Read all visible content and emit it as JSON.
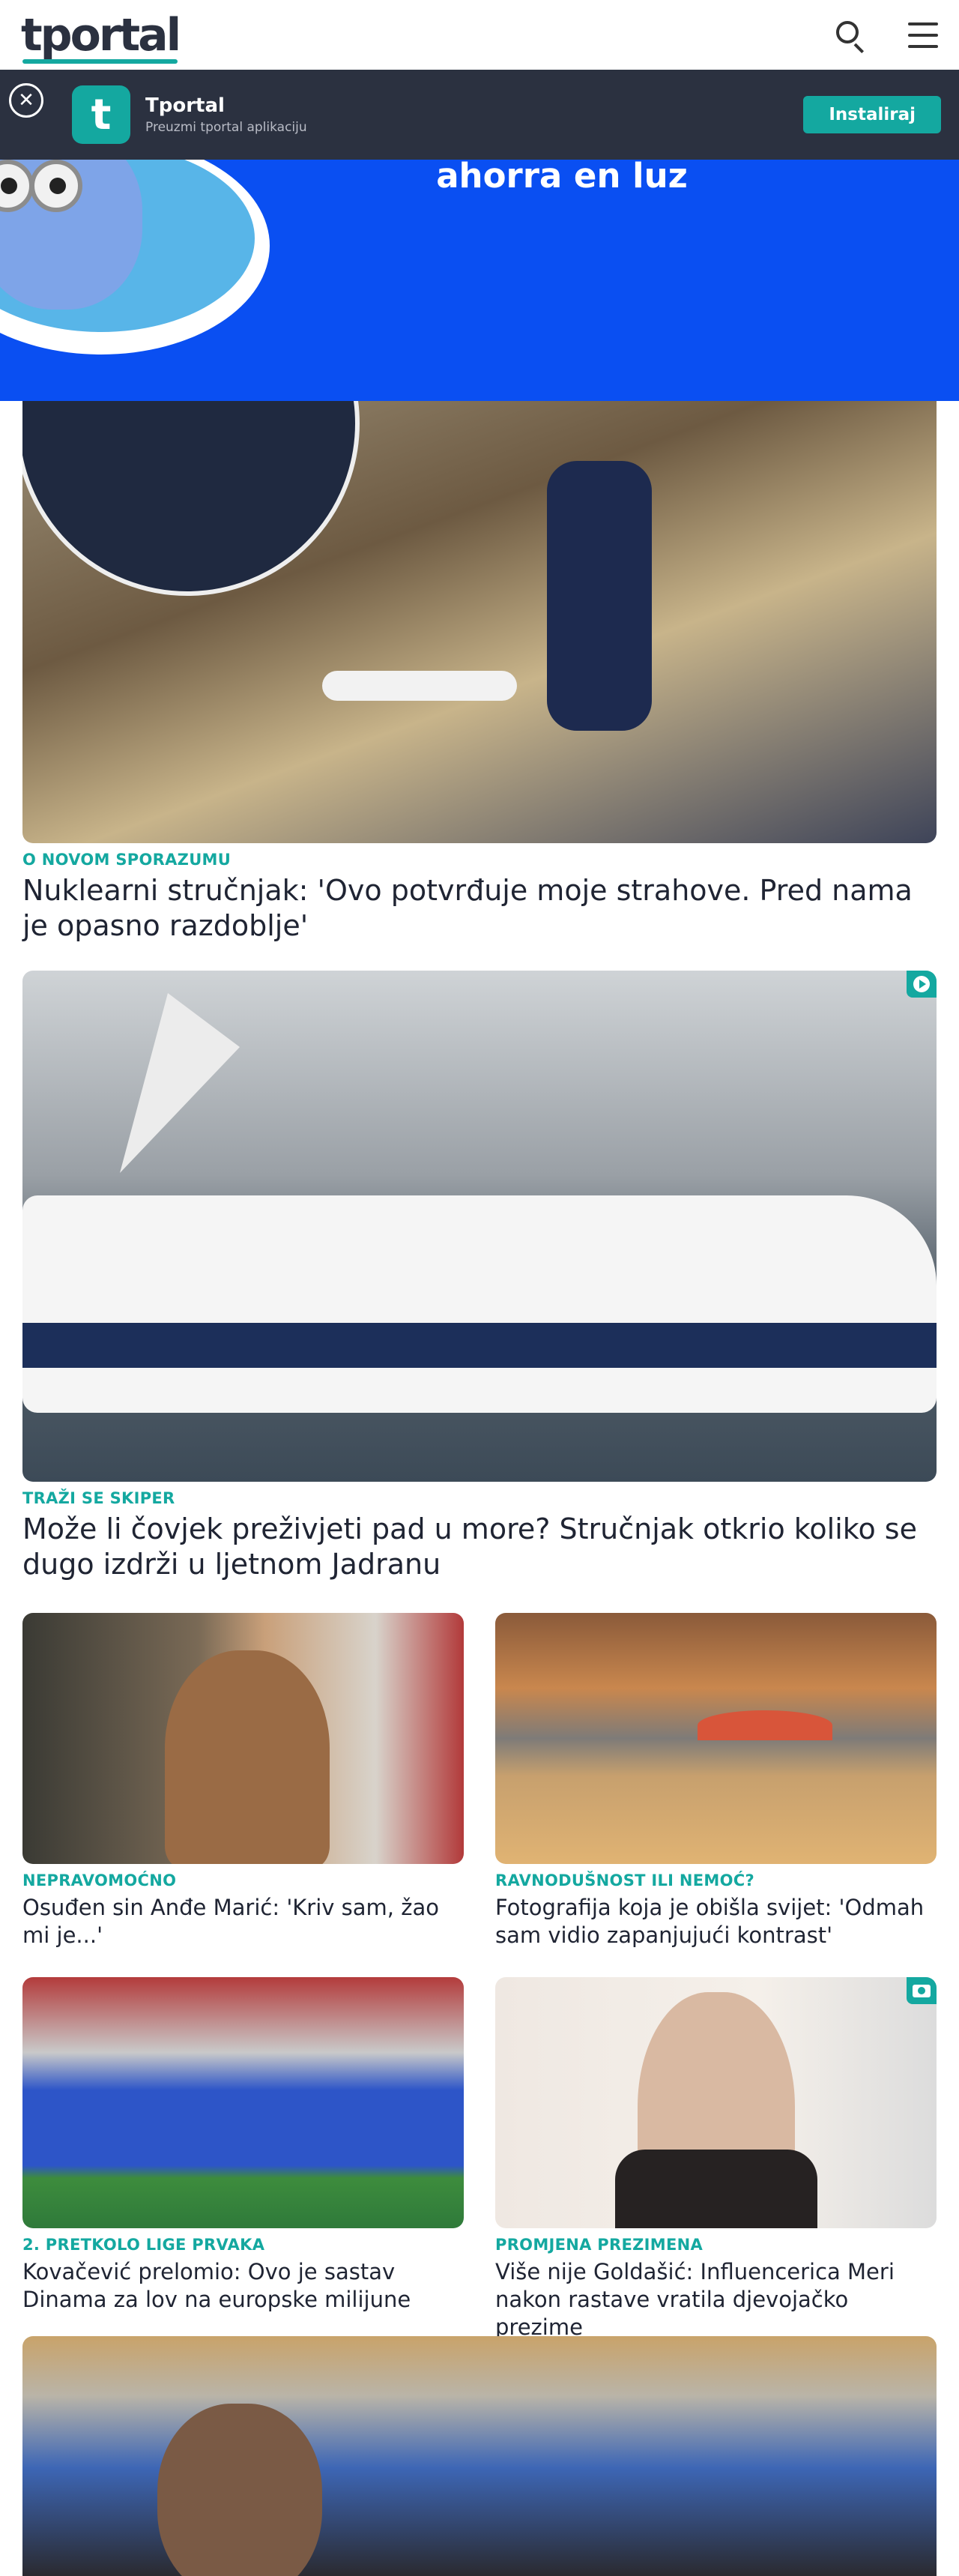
{
  "header": {
    "logo": "tportal",
    "icons": [
      "search-icon",
      "menu-icon"
    ]
  },
  "app_banner": {
    "name": "Tportal",
    "subtitle": "Preuzmi tportal aplikaciju",
    "icon_letter": "t",
    "install_label": "Instaliraj",
    "close_icon": "close-icon"
  },
  "ad": {
    "text": "ahorra en luz"
  },
  "articles": [
    {
      "category": "O NOVOM SPORAZUMU",
      "title": "Nuklearni stručnjak: 'Ovo potvrđuje moje strahove. Pred nama je opasno razdoblje'",
      "badge": null
    },
    {
      "category": "TRAŽI SE SKIPER",
      "title": "Može li čovjek preživjeti pad u more? Stručnjak otkrio koliko se dugo izdrži u ljetnom Jadranu",
      "badge": "play-icon"
    },
    {
      "category": "NEPRAVOMOĆNO",
      "title": "Osuđen sin Anđe Marić: 'Kriv sam, žao mi je...'",
      "badge": null
    },
    {
      "category": "RAVNODUŠNOST ILI NEMOĆ?",
      "title": "Fotografija koja je obišla svijet: 'Odmah sam vidio zapanjujući kontrast'",
      "badge": null
    },
    {
      "category": "2. PRETKOLO LIGE PRVAKA",
      "title": "Kovačević prelomio: Ovo je sastav Dinama za lov na europske milijune",
      "badge": null
    },
    {
      "category": "PROMJENA PREZIMENA",
      "title": "Više nije Goldašić: Influencerica Meri nakon rastave vratila djevojačko prezime",
      "badge": "camera-icon"
    }
  ],
  "colors": {
    "accent": "#14a8a0",
    "dark": "#2b3140",
    "ad_blue": "#0a4ff2"
  }
}
